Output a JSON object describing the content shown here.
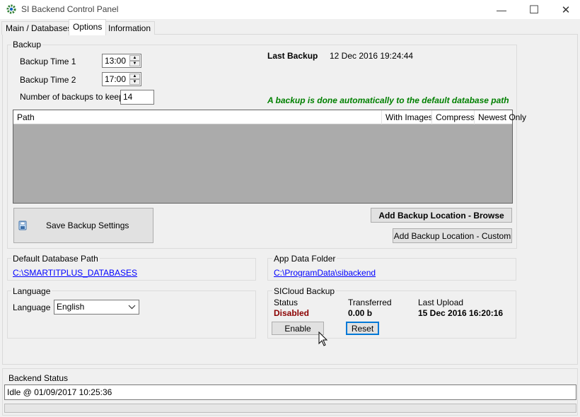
{
  "window": {
    "title": "SI Backend Control Panel",
    "minimize_glyph": "—",
    "maximize_glyph": "☐",
    "close_glyph": "✕"
  },
  "tabs": [
    {
      "label": "Main / Databases",
      "active": false
    },
    {
      "label": "Options",
      "active": true
    },
    {
      "label": "Information",
      "active": false
    }
  ],
  "backup": {
    "group_title": "Backup",
    "time1_label": "Backup Time 1",
    "time1_value": "13:00",
    "time2_label": "Backup Time 2",
    "time2_value": "17:00",
    "count_label": "Number of backups to keep",
    "count_value": "14",
    "last_backup_label": "Last Backup",
    "last_backup_value": "12 Dec 2016 19:24:44",
    "auto_note": "A backup is done automatically to the default database path",
    "grid_columns": [
      "Path",
      "With Images",
      "Compress",
      "Newest Only"
    ],
    "save_button": "Save Backup Settings",
    "add_browse_button": "Add Backup Location - Browse",
    "add_custom_button": "Add Backup Location - Custom"
  },
  "default_db": {
    "group_title": "Default Database Path",
    "path": "C:\\SMARTITPLUS_DATABASES"
  },
  "app_data": {
    "group_title": "App Data Folder",
    "path": "C:\\ProgramData\\sibackend"
  },
  "language": {
    "group_title": "Language",
    "label": "Language",
    "selected": "English"
  },
  "sicloud": {
    "group_title": "SICloud Backup",
    "status_label": "Status",
    "status_value": "Disabled",
    "status_color": "#8b0000",
    "transferred_label": "Transferred",
    "transferred_value": "0.00 b",
    "last_upload_label": "Last Upload",
    "last_upload_value": "15 Dec 2016 16:20:16",
    "enable_button": "Enable",
    "reset_button": "Reset"
  },
  "backend_status": {
    "group_title": "Backend Status",
    "text": "Idle @ 01/09/2017 10:25:36",
    "progress": 0
  },
  "colors": {
    "accent": "#0078d7",
    "note_green": "#008000",
    "link_blue": "#0000ff"
  }
}
